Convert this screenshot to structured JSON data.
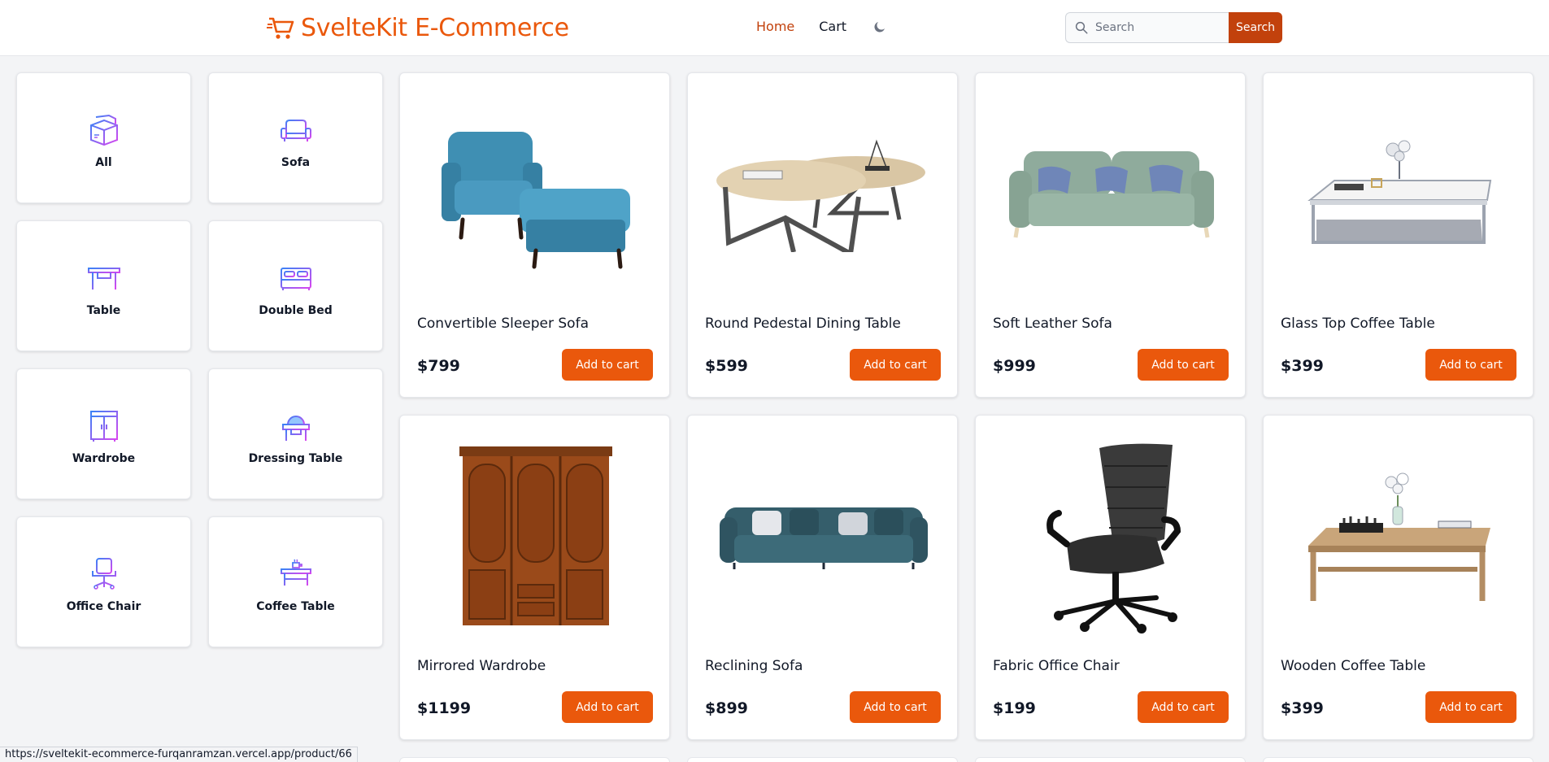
{
  "brand": {
    "name": "SvelteKit E-Commerce",
    "color": "#ea580c"
  },
  "nav": {
    "home": "Home",
    "cart": "Cart"
  },
  "search": {
    "placeholder": "Search",
    "button": "Search"
  },
  "categories": [
    {
      "label": "All",
      "icon": "boxes-icon"
    },
    {
      "label": "Sofa",
      "icon": "sofa-icon"
    },
    {
      "label": "Table",
      "icon": "table-icon"
    },
    {
      "label": "Double Bed",
      "icon": "bed-icon"
    },
    {
      "label": "Wardrobe",
      "icon": "wardrobe-icon"
    },
    {
      "label": "Dressing Table",
      "icon": "dressing-table-icon"
    },
    {
      "label": "Office Chair",
      "icon": "office-chair-icon"
    },
    {
      "label": "Coffee Table",
      "icon": "coffee-table-icon"
    }
  ],
  "products": [
    {
      "name": "Convertible Sleeper Sofa",
      "price": "$799",
      "button": "Add to cart"
    },
    {
      "name": "Round Pedestal Dining Table",
      "price": "$599",
      "button": "Add to cart"
    },
    {
      "name": "Soft Leather Sofa",
      "price": "$999",
      "button": "Add to cart"
    },
    {
      "name": "Glass Top Coffee Table",
      "price": "$399",
      "button": "Add to cart"
    },
    {
      "name": "Mirrored Wardrobe",
      "price": "$1199",
      "button": "Add to cart"
    },
    {
      "name": "Reclining Sofa",
      "price": "$899",
      "button": "Add to cart"
    },
    {
      "name": "Fabric Office Chair",
      "price": "$199",
      "button": "Add to cart"
    },
    {
      "name": "Wooden Coffee Table",
      "price": "$399",
      "button": "Add to cart"
    }
  ],
  "status_url": "https://sveltekit-ecommerce-furqanramzan.vercel.app/product/66"
}
